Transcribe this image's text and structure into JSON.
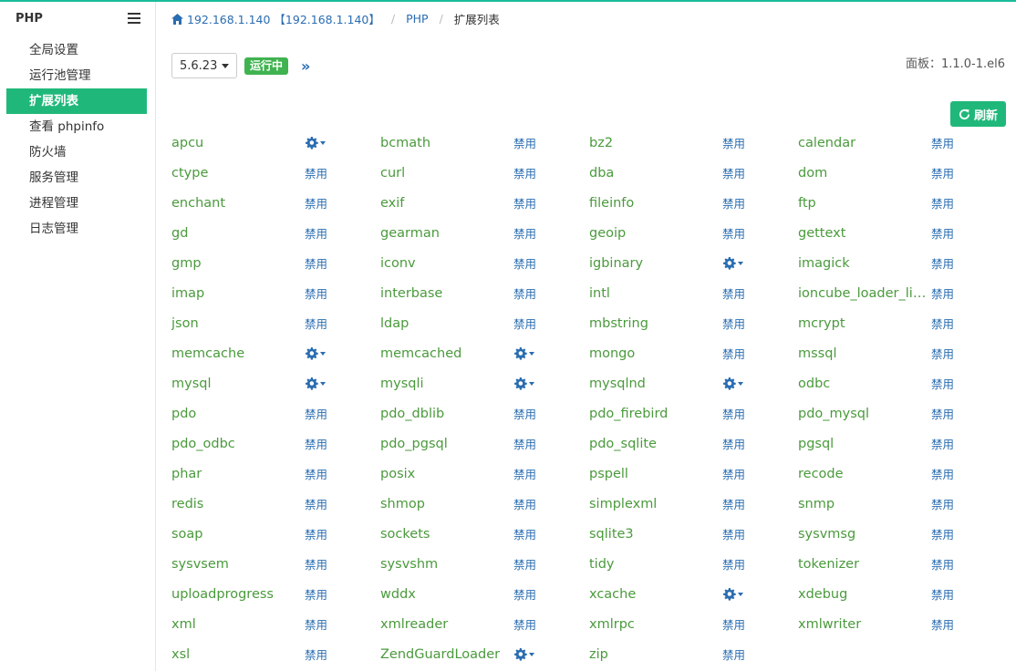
{
  "sidebar": {
    "title": "PHP",
    "items": [
      {
        "label": "全局设置",
        "active": false
      },
      {
        "label": "运行池管理",
        "active": false
      },
      {
        "label": "扩展列表",
        "active": true
      },
      {
        "label": "查看 phpinfo",
        "active": false
      },
      {
        "label": "防火墙",
        "active": false
      },
      {
        "label": "服务管理",
        "active": false
      },
      {
        "label": "进程管理",
        "active": false
      },
      {
        "label": "日志管理",
        "active": false
      }
    ]
  },
  "breadcrumb": {
    "host": "192.168.1.140 【192.168.1.140】",
    "section": "PHP",
    "current": "扩展列表"
  },
  "toolbar": {
    "version": "5.6.23",
    "status": "运行中",
    "more": "»",
    "panel_version": "面板：1.1.0-1.el6",
    "refresh_label": "刷新"
  },
  "colors": {
    "accent": "#20b87a",
    "link": "#2a6db1",
    "ext_name": "#4a9a3c",
    "badge": "#3fb34f"
  },
  "disable_label": "禁用",
  "extensions": [
    [
      {
        "name": "apcu",
        "action": "gear"
      },
      {
        "name": "bcmath",
        "action": "disable"
      },
      {
        "name": "bz2",
        "action": "disable"
      },
      {
        "name": "calendar",
        "action": "disable"
      }
    ],
    [
      {
        "name": "ctype",
        "action": "disable"
      },
      {
        "name": "curl",
        "action": "disable"
      },
      {
        "name": "dba",
        "action": "disable"
      },
      {
        "name": "dom",
        "action": "disable"
      }
    ],
    [
      {
        "name": "enchant",
        "action": "disable"
      },
      {
        "name": "exif",
        "action": "disable"
      },
      {
        "name": "fileinfo",
        "action": "disable"
      },
      {
        "name": "ftp",
        "action": "disable"
      }
    ],
    [
      {
        "name": "gd",
        "action": "disable"
      },
      {
        "name": "gearman",
        "action": "disable"
      },
      {
        "name": "geoip",
        "action": "disable"
      },
      {
        "name": "gettext",
        "action": "disable"
      }
    ],
    [
      {
        "name": "gmp",
        "action": "disable"
      },
      {
        "name": "iconv",
        "action": "disable"
      },
      {
        "name": "igbinary",
        "action": "gear"
      },
      {
        "name": "imagick",
        "action": "disable"
      }
    ],
    [
      {
        "name": "imap",
        "action": "disable"
      },
      {
        "name": "interbase",
        "action": "disable"
      },
      {
        "name": "intl",
        "action": "disable"
      },
      {
        "name": "ioncube_loader_lin...",
        "action": "disable"
      }
    ],
    [
      {
        "name": "json",
        "action": "disable"
      },
      {
        "name": "ldap",
        "action": "disable"
      },
      {
        "name": "mbstring",
        "action": "disable"
      },
      {
        "name": "mcrypt",
        "action": "disable"
      }
    ],
    [
      {
        "name": "memcache",
        "action": "gear"
      },
      {
        "name": "memcached",
        "action": "gear"
      },
      {
        "name": "mongo",
        "action": "disable"
      },
      {
        "name": "mssql",
        "action": "disable"
      }
    ],
    [
      {
        "name": "mysql",
        "action": "gear"
      },
      {
        "name": "mysqli",
        "action": "gear"
      },
      {
        "name": "mysqlnd",
        "action": "gear"
      },
      {
        "name": "odbc",
        "action": "disable"
      }
    ],
    [
      {
        "name": "pdo",
        "action": "disable"
      },
      {
        "name": "pdo_dblib",
        "action": "disable"
      },
      {
        "name": "pdo_firebird",
        "action": "disable"
      },
      {
        "name": "pdo_mysql",
        "action": "disable"
      }
    ],
    [
      {
        "name": "pdo_odbc",
        "action": "disable"
      },
      {
        "name": "pdo_pgsql",
        "action": "disable"
      },
      {
        "name": "pdo_sqlite",
        "action": "disable"
      },
      {
        "name": "pgsql",
        "action": "disable"
      }
    ],
    [
      {
        "name": "phar",
        "action": "disable"
      },
      {
        "name": "posix",
        "action": "disable"
      },
      {
        "name": "pspell",
        "action": "disable"
      },
      {
        "name": "recode",
        "action": "disable"
      }
    ],
    [
      {
        "name": "redis",
        "action": "disable"
      },
      {
        "name": "shmop",
        "action": "disable"
      },
      {
        "name": "simplexml",
        "action": "disable"
      },
      {
        "name": "snmp",
        "action": "disable"
      }
    ],
    [
      {
        "name": "soap",
        "action": "disable"
      },
      {
        "name": "sockets",
        "action": "disable"
      },
      {
        "name": "sqlite3",
        "action": "disable"
      },
      {
        "name": "sysvmsg",
        "action": "disable"
      }
    ],
    [
      {
        "name": "sysvsem",
        "action": "disable"
      },
      {
        "name": "sysvshm",
        "action": "disable"
      },
      {
        "name": "tidy",
        "action": "disable"
      },
      {
        "name": "tokenizer",
        "action": "disable"
      }
    ],
    [
      {
        "name": "uploadprogress",
        "action": "disable"
      },
      {
        "name": "wddx",
        "action": "disable"
      },
      {
        "name": "xcache",
        "action": "gear"
      },
      {
        "name": "xdebug",
        "action": "disable"
      }
    ],
    [
      {
        "name": "xml",
        "action": "disable"
      },
      {
        "name": "xmlreader",
        "action": "disable"
      },
      {
        "name": "xmlrpc",
        "action": "disable"
      },
      {
        "name": "xmlwriter",
        "action": "disable"
      }
    ],
    [
      {
        "name": "xsl",
        "action": "disable"
      },
      {
        "name": "ZendGuardLoader",
        "action": "gear"
      },
      {
        "name": "zip",
        "action": "disable"
      }
    ]
  ]
}
